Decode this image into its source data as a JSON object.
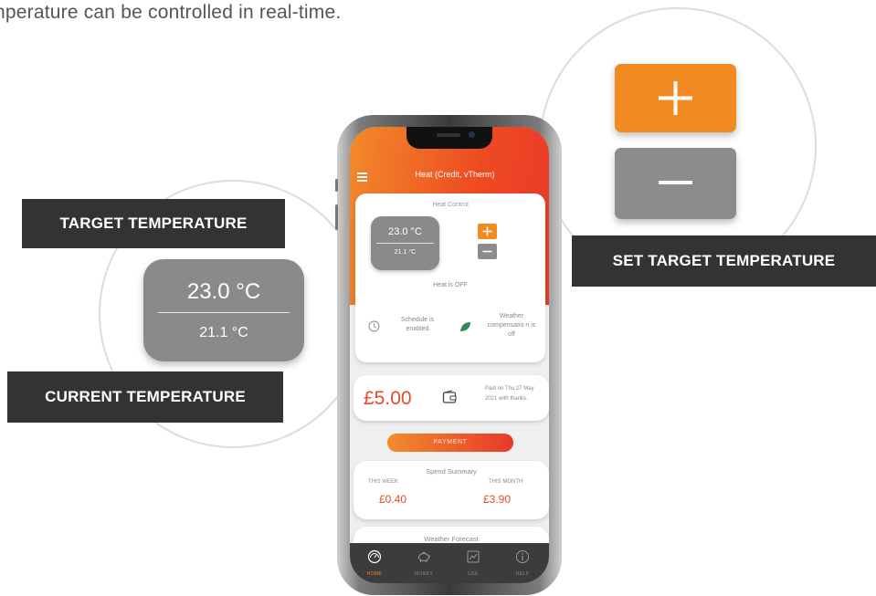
{
  "intro_text": "nperature can be controlled in real-time.",
  "callouts": {
    "target_temperature": "TARGET TEMPERATURE",
    "current_temperature": "CURRENT TEMPERATURE",
    "set_target_temperature": "SET TARGET TEMPERATURE"
  },
  "zoom": {
    "target_value": "23.0 °C",
    "current_value": "21.1 °C"
  },
  "app": {
    "title": "Heat (Credit, vTherm)",
    "heat_control": {
      "title": "Heat Control",
      "target_value": "23.0 °C",
      "current_value": "21.1 °C",
      "status": "Heat is OFF",
      "schedule_text": "Schedule is enabled",
      "weather_text": "Weather compensatio n is off"
    },
    "payment_card": {
      "amount": "£5.00",
      "paid_text": "Paid on Thu 27 May 2021 with thanks.",
      "button_label": "PAYMENT"
    },
    "spend_summary": {
      "title": "Spend Summary",
      "week_label": "THIS WEEK",
      "month_label": "THIS MONTH",
      "week_value": "£0.40",
      "month_value": "£3.90"
    },
    "weather_forecast": {
      "title": "Weather Forecast"
    },
    "nav": [
      {
        "label": "HOME",
        "icon": "home-gauge-icon",
        "active": true
      },
      {
        "label": "MONEY",
        "icon": "piggy-bank-icon",
        "active": false
      },
      {
        "label": "USE",
        "icon": "chart-icon",
        "active": false
      },
      {
        "label": "HELP",
        "icon": "info-icon",
        "active": false
      }
    ]
  },
  "colors": {
    "accent_orange": "#f28a22",
    "accent_red": "#e8392a",
    "grey_button": "#8c8c8c",
    "callout_bg": "#333333",
    "nav_bg": "#3c3c3c"
  }
}
